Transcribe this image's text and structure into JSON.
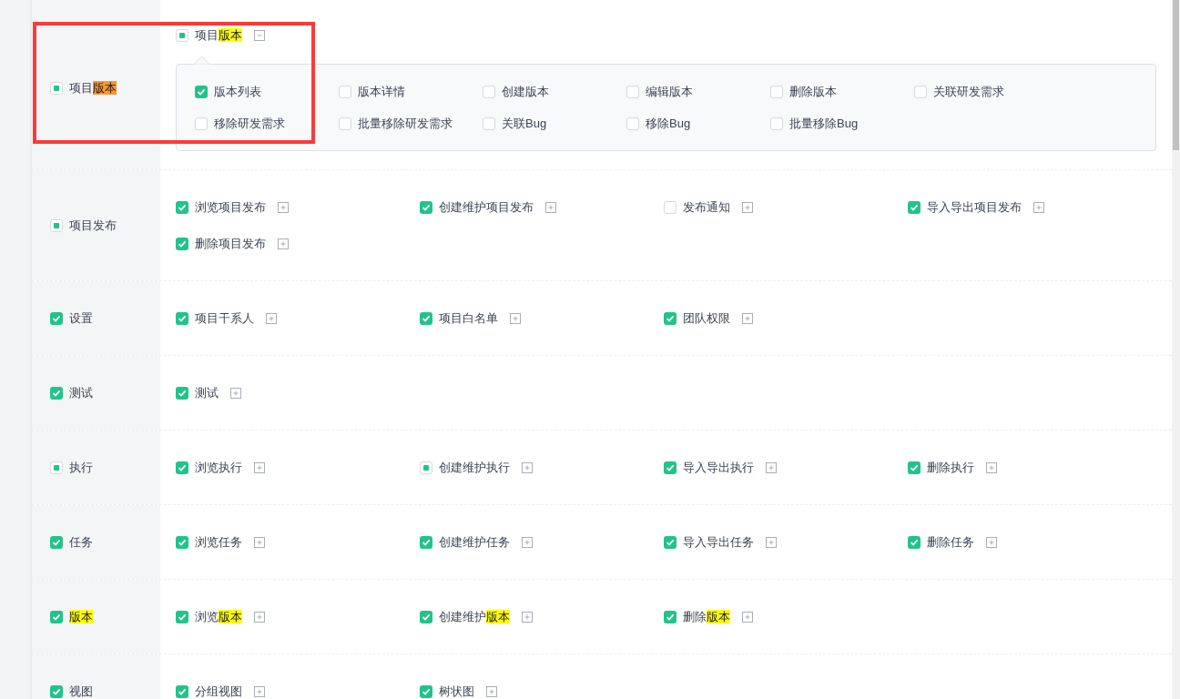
{
  "rows": [
    {
      "label_parts": [
        {
          "text": "项目",
          "highlighted": false,
          "current": false
        },
        {
          "text": "版本",
          "highlighted": true,
          "current": true
        }
      ],
      "checked": true,
      "indeterminate": true,
      "items": [
        {
          "label_parts": [
            {
              "text": "项目",
              "highlighted": false,
              "current": false
            },
            {
              "text": "版本",
              "highlighted": true,
              "current": false
            }
          ],
          "checked": true,
          "indeterminate": true,
          "expanded": true,
          "submenu": [
            {
              "label": "版本列表",
              "checked": true
            },
            {
              "label": "版本详情",
              "checked": false
            },
            {
              "label": "创建版本",
              "checked": false
            },
            {
              "label": "编辑版本",
              "checked": false
            },
            {
              "label": "删除版本",
              "checked": false
            },
            {
              "label": "关联研发需求",
              "checked": false
            },
            {
              "label": "移除研发需求",
              "checked": false
            },
            {
              "label": "批量移除研发需求",
              "checked": false
            },
            {
              "label": "关联Bug",
              "checked": false
            },
            {
              "label": "移除Bug",
              "checked": false
            },
            {
              "label": "批量移除Bug",
              "checked": false
            }
          ]
        }
      ]
    },
    {
      "label": "项目发布",
      "checked": true,
      "indeterminate": true,
      "items": [
        {
          "label": "浏览项目发布",
          "checked": true,
          "indeterminate": false,
          "expanded": false
        },
        {
          "label": "创建维护项目发布",
          "checked": true,
          "indeterminate": false,
          "expanded": false
        },
        {
          "label": "发布通知",
          "checked": false,
          "indeterminate": false,
          "expanded": false
        },
        {
          "label": "导入导出项目发布",
          "checked": true,
          "indeterminate": false,
          "expanded": false
        },
        {
          "label": "删除项目发布",
          "checked": true,
          "indeterminate": false,
          "expanded": false
        }
      ]
    },
    {
      "label": "设置",
      "checked": true,
      "indeterminate": false,
      "items": [
        {
          "label": "项目干系人",
          "checked": true,
          "indeterminate": false,
          "expanded": false
        },
        {
          "label": "项目白名单",
          "checked": true,
          "indeterminate": false,
          "expanded": false
        },
        {
          "label": "团队权限",
          "checked": true,
          "indeterminate": false,
          "expanded": false
        }
      ]
    },
    {
      "label": "测试",
      "checked": true,
      "indeterminate": false,
      "items": [
        {
          "label": "测试",
          "checked": true,
          "indeterminate": false,
          "expanded": false
        }
      ]
    },
    {
      "label": "执行",
      "checked": true,
      "indeterminate": true,
      "items": [
        {
          "label": "浏览执行",
          "checked": true,
          "indeterminate": false,
          "expanded": false
        },
        {
          "label": "创建维护执行",
          "checked": true,
          "indeterminate": true,
          "expanded": false
        },
        {
          "label": "导入导出执行",
          "checked": true,
          "indeterminate": false,
          "expanded": false
        },
        {
          "label": "删除执行",
          "checked": true,
          "indeterminate": false,
          "expanded": false
        }
      ]
    },
    {
      "label": "任务",
      "checked": true,
      "indeterminate": false,
      "items": [
        {
          "label": "浏览任务",
          "checked": true,
          "indeterminate": false,
          "expanded": false
        },
        {
          "label": "创建维护任务",
          "checked": true,
          "indeterminate": false,
          "expanded": false
        },
        {
          "label": "导入导出任务",
          "checked": true,
          "indeterminate": false,
          "expanded": false
        },
        {
          "label": "删除任务",
          "checked": true,
          "indeterminate": false,
          "expanded": false
        }
      ]
    },
    {
      "label_parts": [
        {
          "text": "版本",
          "highlighted": true,
          "current": false
        }
      ],
      "checked": true,
      "indeterminate": false,
      "items": [
        {
          "label_parts": [
            {
              "text": "浏览",
              "highlighted": false,
              "current": false
            },
            {
              "text": "版本",
              "highlighted": true,
              "current": false
            }
          ],
          "checked": true,
          "indeterminate": false,
          "expanded": false
        },
        {
          "label_parts": [
            {
              "text": "创建维护",
              "highlighted": false,
              "current": false
            },
            {
              "text": "版本",
              "highlighted": true,
              "current": false
            }
          ],
          "checked": true,
          "indeterminate": false,
          "expanded": false
        },
        {
          "label_parts": [
            {
              "text": "删除",
              "highlighted": false,
              "current": false
            },
            {
              "text": "版本",
              "highlighted": true,
              "current": false
            }
          ],
          "checked": true,
          "indeterminate": false,
          "expanded": false
        }
      ]
    },
    {
      "label": "视图",
      "checked": true,
      "indeterminate": false,
      "items": [
        {
          "label": "分组视图",
          "checked": true,
          "indeterminate": false,
          "expanded": false
        },
        {
          "label": "树状图",
          "checked": true,
          "indeterminate": false,
          "expanded": false
        }
      ]
    }
  ],
  "annotations": [
    {
      "kind": "frame"
    }
  ]
}
